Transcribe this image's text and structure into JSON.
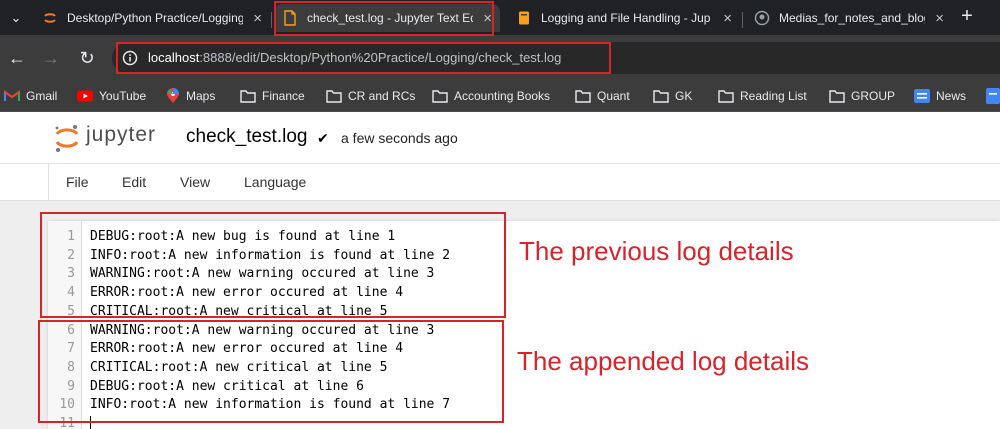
{
  "browser": {
    "tabs": [
      {
        "title": "Desktop/Python Practice/Logging",
        "icon": "jupyter-favicon-icon",
        "active": false
      },
      {
        "title": "check_test.log - Jupyter Text Edi",
        "icon": "file-icon",
        "active": true
      },
      {
        "title": "Logging and File Handling - Jup",
        "icon": "notebook-icon",
        "active": false
      },
      {
        "title": "Medias_for_notes_and_blogs/lo",
        "icon": "github-icon",
        "active": false
      }
    ],
    "new_tab_label": "+",
    "url_host": "localhost",
    "url_rest": ":8888/edit/Desktop/Python%20Practice/Logging/check_test.log",
    "bookmarks": [
      {
        "label": "Gmail",
        "icon": "gmail-icon"
      },
      {
        "label": "YouTube",
        "icon": "youtube-icon"
      },
      {
        "label": "Maps",
        "icon": "maps-icon"
      },
      {
        "label": "Finance",
        "icon": "folder-icon"
      },
      {
        "label": "CR and RCs",
        "icon": "folder-icon"
      },
      {
        "label": "Accounting Books",
        "icon": "folder-icon"
      },
      {
        "label": "Quant",
        "icon": "folder-icon"
      },
      {
        "label": "GK",
        "icon": "folder-icon"
      },
      {
        "label": "Reading List",
        "icon": "folder-icon"
      },
      {
        "label": "GROUP",
        "icon": "folder-icon"
      },
      {
        "label": "News",
        "icon": "google-news-icon"
      }
    ]
  },
  "jupyter": {
    "brand": "jupyter",
    "filename": "check_test.log",
    "save_status": "a few seconds ago",
    "menu": [
      "File",
      "Edit",
      "View",
      "Language"
    ]
  },
  "editor": {
    "lines": [
      {
        "n": "1",
        "text": "DEBUG:root:A new bug is found at line 1"
      },
      {
        "n": "2",
        "text": "INFO:root:A new information is found at line 2"
      },
      {
        "n": "3",
        "text": "WARNING:root:A new warning occured at line 3"
      },
      {
        "n": "4",
        "text": "ERROR:root:A new error occured at line 4"
      },
      {
        "n": "5",
        "text": "CRITICAL:root:A new critical at line 5"
      },
      {
        "n": "6",
        "text": "WARNING:root:A new warning occured at line 3"
      },
      {
        "n": "7",
        "text": "ERROR:root:A new error occured at line 4"
      },
      {
        "n": "8",
        "text": "CRITICAL:root:A new critical at line 5"
      },
      {
        "n": "9",
        "text": "DEBUG:root:A new critical at line 6"
      },
      {
        "n": "10",
        "text": "INFO:root:A new information is found at line 7"
      },
      {
        "n": "11",
        "text": ""
      }
    ]
  },
  "annotations": {
    "previous": "The previous log details",
    "appended": "The appended log details",
    "color": "#d9232a"
  }
}
